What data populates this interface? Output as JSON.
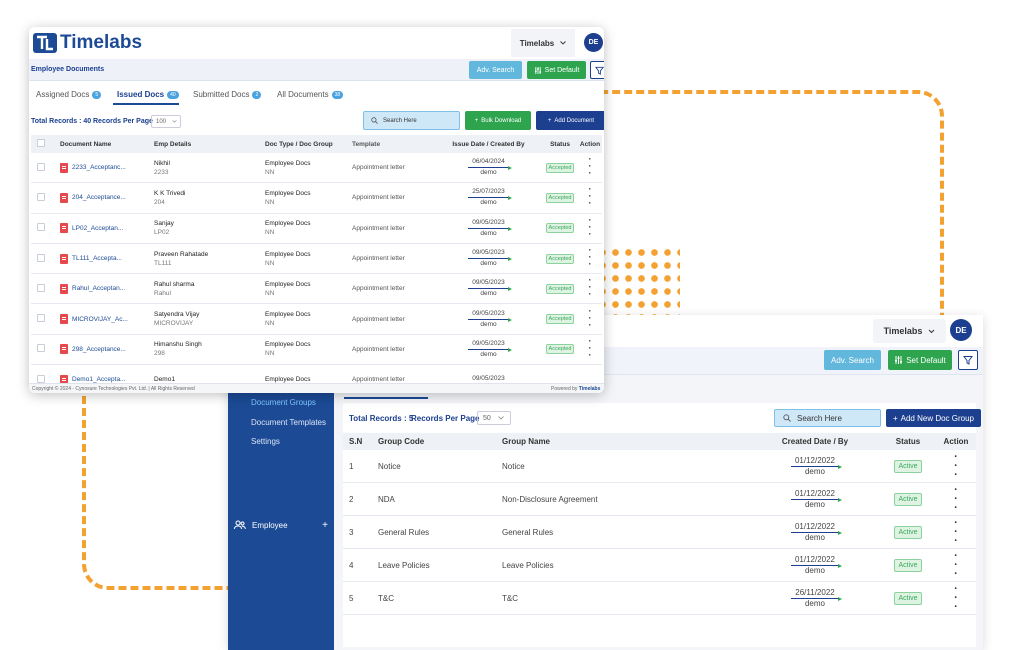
{
  "brand": {
    "name": "Timelabs",
    "colors": {
      "primary": "#1c4a95",
      "accent": "#f3a232",
      "success": "#2ea44f",
      "info": "#62b7dc"
    }
  },
  "front": {
    "org_label": "Timelabs",
    "avatar_initials": "DE",
    "page_title": "Employee Documents",
    "adv_search_label": "Adv. Search",
    "set_default_label": "Set Default",
    "tabs": [
      {
        "label": "Assigned Docs",
        "count": "5"
      },
      {
        "label": "Issued Docs",
        "count": "40"
      },
      {
        "label": "Submitted Docs",
        "count": "2"
      },
      {
        "label": "All Documents",
        "count": "38"
      }
    ],
    "total_records": "Total Records : 40",
    "records_per_page_label": "Records Per Page",
    "records_per_page_value": "100",
    "search_placeholder": "Search Here",
    "bulk_download_label": "Bulk Download",
    "add_document_label": "Add Document",
    "columns": [
      "Document Name",
      "Emp Details",
      "Doc Type / Doc Group",
      "Template",
      "Issue Date / Created By",
      "Status",
      "Action"
    ],
    "rows": [
      {
        "doc": "2233_Acceptanc...",
        "emp": "Nikhil",
        "code": "2233",
        "type": "Employee Docs",
        "group": "NN",
        "template": "Appointment letter",
        "date": "06/04/2024",
        "by": "demo",
        "status": "Accepted"
      },
      {
        "doc": "204_Acceptance...",
        "emp": "K K Trivedi",
        "code": "204",
        "type": "Employee Docs",
        "group": "NN",
        "template": "Appointment letter",
        "date": "25/07/2023",
        "by": "demo",
        "status": "Accepted"
      },
      {
        "doc": "LP02_Acceptan...",
        "emp": "Sanjay",
        "code": "LP02",
        "type": "Employee Docs",
        "group": "NN",
        "template": "Appointment letter",
        "date": "09/05/2023",
        "by": "demo",
        "status": "Accepted"
      },
      {
        "doc": "TL111_Accepta...",
        "emp": "Praveen Rahatade",
        "code": "TL111",
        "type": "Employee Docs",
        "group": "NN",
        "template": "Appointment letter",
        "date": "09/05/2023",
        "by": "demo",
        "status": "Accepted"
      },
      {
        "doc": "Rahul_Acceptan...",
        "emp": "Rahul sharma",
        "code": "Rahul",
        "type": "Employee Docs",
        "group": "NN",
        "template": "Appointment letter",
        "date": "09/05/2023",
        "by": "demo",
        "status": "Accepted"
      },
      {
        "doc": "MICROVIJAY_Ac...",
        "emp": "Satyendra Vijay",
        "code": "MICROVIJAY",
        "type": "Employee Docs",
        "group": "NN",
        "template": "Appointment letter",
        "date": "09/05/2023",
        "by": "demo",
        "status": "Accepted"
      },
      {
        "doc": "298_Acceptance...",
        "emp": "Himanshu Singh",
        "code": "298",
        "type": "Employee Docs",
        "group": "NN",
        "template": "Appointment letter",
        "date": "09/05/2023",
        "by": "demo",
        "status": "Accepted"
      },
      {
        "doc": "Demo1_Accepta...",
        "emp": "Demo1",
        "code": "",
        "type": "Employee Docs",
        "group": "",
        "template": "Appointment letter",
        "date": "09/05/2023",
        "by": "",
        "status": ""
      }
    ],
    "footer_copyright": "Copyright © 2024 - Cynosure Technologies Pvt. Ltd. | All Rights Reserved",
    "footer_powered_prefix": "Powered by",
    "footer_powered_brand": "Timelabs"
  },
  "back": {
    "org_label": "Timelabs",
    "avatar_initials": "DE",
    "adv_search_label": "Adv. Search",
    "set_default_label": "Set Default",
    "sidebar": [
      {
        "label": "Document Groups",
        "active": true
      },
      {
        "label": "Document Templates",
        "active": false
      },
      {
        "label": "Settings",
        "active": false
      }
    ],
    "sidebar_employee_label": "Employee",
    "total_records": "Total Records : 5",
    "records_per_page_label": "Records Per Page",
    "records_per_page_value": "50",
    "search_placeholder": "Search Here",
    "add_group_label": "Add New Doc Group",
    "columns": [
      "S.N",
      "Group Code",
      "Group Name",
      "Created Date / By",
      "Status",
      "Action"
    ],
    "rows": [
      {
        "sn": "1",
        "code": "Notice",
        "name": "Notice",
        "date": "01/12/2022",
        "by": "demo",
        "status": "Active"
      },
      {
        "sn": "2",
        "code": "NDA",
        "name": "Non-Disclosure Agreement",
        "date": "01/12/2022",
        "by": "demo",
        "status": "Active"
      },
      {
        "sn": "3",
        "code": "General Rules",
        "name": "General Rules",
        "date": "01/12/2022",
        "by": "demo",
        "status": "Active"
      },
      {
        "sn": "4",
        "code": "Leave Policies",
        "name": "Leave Policies",
        "date": "01/12/2022",
        "by": "demo",
        "status": "Active"
      },
      {
        "sn": "5",
        "code": "T&C",
        "name": "T&C",
        "date": "26/11/2022",
        "by": "demo",
        "status": "Active"
      }
    ]
  }
}
